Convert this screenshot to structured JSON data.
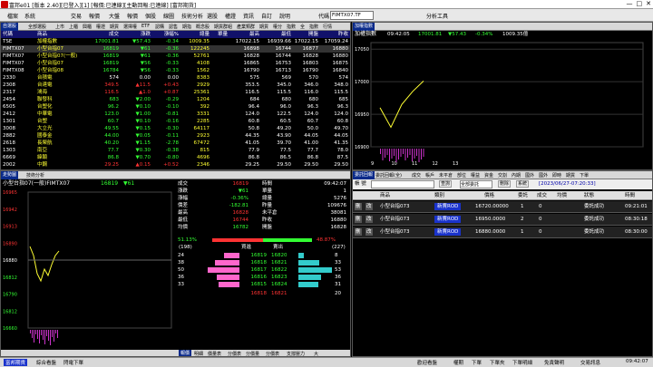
{
  "window": {
    "title": "富邦e01 [版本 2.40][已登入][1] [報價:已連線][主動回報:已連線] [富邦期貨]"
  },
  "menu": [
    "檔案",
    "系統",
    "交易",
    "報價",
    "大盤",
    "報價",
    "個股",
    "線圖",
    "技術分析",
    "選股",
    "權證",
    "資訊",
    "自訂",
    "說明"
  ],
  "menu_extra": [
    "代碼",
    "分析工具"
  ],
  "code_input": "FIMTX07.TF",
  "quote_panel": {
    "tabs": [
      "自選股",
      "全部選股",
      "上市",
      "上櫃",
      "興櫃",
      "權證",
      "期貨",
      "選擇權",
      "ETF",
      "認購",
      "認售",
      "期指",
      "概念股",
      "期貨群組",
      "產業類群",
      "期貨",
      "權分",
      "指數",
      "全",
      "指數",
      "行情",
      "期貨",
      "國際",
      "指數",
      "期貨",
      "指數"
    ],
    "headers": [
      "代碼",
      "商品",
      "成交",
      "漲跌",
      "漲幅%",
      "總量",
      "單量",
      "最高",
      "最低",
      "開盤",
      "昨收"
    ],
    "rows": [
      [
        "TSE",
        "加權指數",
        "17001.81",
        "▼57.43",
        "-0.34",
        "1009.35",
        "",
        "17022.15",
        "16939.66",
        "17022.15",
        "17059.24"
      ],
      [
        "FIMTX07",
        "小型台指07",
        "16819",
        "▼61",
        "-0.36",
        "122245",
        "",
        "16898",
        "16744",
        "16877",
        "16880"
      ],
      [
        "FIMTX07",
        "小型台指07(一般)",
        "16819",
        "▼61",
        "-0.36",
        "52761",
        "",
        "16828",
        "16744",
        "16828",
        "16880"
      ],
      [
        "FIMTX07",
        "小型台指07",
        "16819",
        "▼56",
        "-0.33",
        "4108",
        "",
        "16865",
        "16753",
        "16803",
        "16875"
      ],
      [
        "FIMTX08",
        "小型台指08",
        "16784",
        "▼56",
        "-0.33",
        "1562",
        "",
        "16790",
        "16713",
        "16790",
        "16840"
      ],
      [
        "2330",
        "台積電",
        "574",
        "0.00",
        "0.00",
        "8383",
        "",
        "575",
        "569",
        "570",
        "574"
      ],
      [
        "2308",
        "台達電",
        "349.5",
        "▲11.5",
        "+0.43",
        "2929",
        "",
        "353.5",
        "345.0",
        "346.0",
        "348.0"
      ],
      [
        "2317",
        "鴻海",
        "116.5",
        "▲1.0",
        "+0.87",
        "25361",
        "",
        "116.5",
        "115.5",
        "116.0",
        "115.5"
      ],
      [
        "2454",
        "聯發科",
        "683",
        "▼2.00",
        "-0.29",
        "1204",
        "",
        "684",
        "680",
        "680",
        "685"
      ],
      [
        "6505",
        "台塑化",
        "96.2",
        "▼0.10",
        "-0.10",
        "392",
        "",
        "96.4",
        "96.0",
        "96.3",
        "96.3"
      ],
      [
        "2412",
        "中華電",
        "123.0",
        "▼1.00",
        "-0.81",
        "3331",
        "",
        "124.0",
        "122.5",
        "124.0",
        "124.0"
      ],
      [
        "1301",
        "台塑",
        "60.7",
        "▼0.10",
        "-0.16",
        "2285",
        "",
        "60.8",
        "60.5",
        "60.7",
        "60.8"
      ],
      [
        "3008",
        "大立光",
        "49.55",
        "▼0.15",
        "-0.30",
        "64117",
        "",
        "50.8",
        "49.20",
        "50.0",
        "49.70"
      ],
      [
        "2882",
        "國泰金",
        "44.00",
        "▼0.05",
        "-0.11",
        "2923",
        "",
        "44.35",
        "43.90",
        "44.05",
        "44.05"
      ],
      [
        "2618",
        "長榮航",
        "40.20",
        "▼1.15",
        "-2.78",
        "67472",
        "",
        "41.05",
        "39.70",
        "41.00",
        "41.35"
      ],
      [
        "1303",
        "南亞",
        "77.7",
        "▼0.30",
        "-0.38",
        "815",
        "",
        "77.9",
        "77.5",
        "77.7",
        "78.0"
      ],
      [
        "6669",
        "緯穎",
        "86.8",
        "▼0.70",
        "-0.80",
        "4696",
        "",
        "86.8",
        "86.5",
        "86.8",
        "87.5"
      ],
      [
        "2002",
        "中鋼",
        "29.25",
        "▲0.15",
        "+0.52",
        "2346",
        "",
        "29.25",
        "29.50",
        "29.50",
        "29.50"
      ]
    ]
  },
  "index_chart": {
    "title": "加權指數",
    "time": "09:42:05",
    "last": "17001.81",
    "change": "▼57.43",
    "pct": "-0.34%",
    "vol": "1009.35億",
    "price_ticks": [
      "17050",
      "17000",
      "16950",
      "16900"
    ],
    "time_ticks": [
      "9",
      "10",
      "11",
      "12",
      "13"
    ],
    "chart_data": {
      "type": "line",
      "x": [
        "9",
        "10",
        "11",
        "12",
        "13"
      ],
      "series": [
        {
          "values": [
            16960,
            16930,
            16965,
            16985,
            17001
          ]
        }
      ],
      "ylim": [
        16900,
        17060
      ]
    }
  },
  "detail_panel": {
    "tabs": [
      "走勢圖",
      "技術分析"
    ],
    "product": "小型台指07(一般)FIMTX07",
    "last": "16819",
    "change": "▼61",
    "labels": [
      "成交",
      "漲跌",
      "漲幅",
      "價差",
      "最高",
      "最低",
      "均價"
    ],
    "values": [
      "16819",
      "▼61",
      "-0.36%",
      "-182.81",
      "16828",
      "16744",
      "16782"
    ],
    "labels2": [
      "時間",
      "單量",
      "總量",
      "昨量",
      "未平倉",
      "昨收",
      "開盤"
    ],
    "values2": [
      "09:42:07",
      "1",
      "5276",
      "109676",
      "38081",
      "16880",
      "16828"
    ],
    "price_ticks": [
      "16965",
      "16942",
      "16913",
      "16890",
      "16880",
      "16812",
      "16790",
      "16812",
      "16660"
    ],
    "ratio_left": "51.13%",
    "ratio_right": "48.87%",
    "count_left": "(198)",
    "count_right": "(227)",
    "book_head": [
      "買進",
      "賣出"
    ],
    "book": [
      {
        "bq": "24",
        "bp": "16819",
        "ap": "16820",
        "aq": "8"
      },
      {
        "bq": "38",
        "bp": "16818",
        "ap": "16821",
        "aq": "33"
      },
      {
        "bq": "50",
        "bp": "16817",
        "ap": "16822",
        "aq": "53"
      },
      {
        "bq": "36",
        "bp": "16816",
        "ap": "16823",
        "aq": "36"
      },
      {
        "bq": "33",
        "bp": "16815",
        "ap": "16824",
        "aq": "31"
      }
    ],
    "book_total": {
      "bq": "",
      "bp": "16818",
      "ap": "16821",
      "aq": "20"
    },
    "time_ticks": [
      "8:45",
      "10",
      "11",
      "12",
      "13:45"
    ],
    "bottom_tabs": [
      "報價",
      "明細",
      "價量表",
      "分價表",
      "分價量",
      "分價表",
      "支撐壓力",
      "大"
    ]
  },
  "order_panel": {
    "tabs": [
      "委託回報",
      "委託回報(全)",
      "成交",
      "帳戶",
      "未平倉",
      "部位",
      "權益",
      "資金",
      "交割",
      "內期",
      "國外",
      "國外",
      "即時",
      "期貨",
      "下單"
    ],
    "account_label": "帳 號",
    "account_value": "",
    "btn_query": "查詢",
    "filter": "全部委託",
    "btn_delete": "刪除",
    "btn_system": "系統",
    "timestamp": "[2023/06/27-07:20:33]",
    "headers": [
      "商品",
      "類別",
      "價格",
      "委託",
      "成交",
      "均價",
      "狀態",
      "時間"
    ],
    "rows": [
      {
        "flag1": "刪",
        "flag2": "改",
        "product": "小型台指073",
        "type": "新賣ROD",
        "price": "16720.00000",
        "qty": "1",
        "fill": "0",
        "avg": "",
        "status": "委託成功",
        "time": "09:21:01"
      },
      {
        "flag1": "刪",
        "flag2": "改",
        "product": "小型台指073",
        "type": "新賣ROD",
        "price": "16950.0000",
        "qty": "2",
        "fill": "0",
        "avg": "",
        "status": "委託成功",
        "time": "08:30:18"
      },
      {
        "flag1": "刪",
        "flag2": "改",
        "product": "小型台指073",
        "type": "新賣ROD",
        "price": "16880.0000",
        "qty": "1",
        "fill": "0",
        "avg": "",
        "status": "委託成功",
        "time": "08:30:00"
      }
    ]
  },
  "statusbar": {
    "left": [
      "富邦期貨",
      "綜合看盤",
      "閃電下單"
    ],
    "right": [
      "歡迎看盤",
      "權期",
      "下單",
      "下單夾",
      "下單明細",
      "免責聲明",
      "交易訊息",
      "09:42:07"
    ]
  },
  "colors": {
    "up": "#ff3333",
    "down": "#33ff33",
    "header": "#11116a",
    "accent": "#1a33cc"
  }
}
